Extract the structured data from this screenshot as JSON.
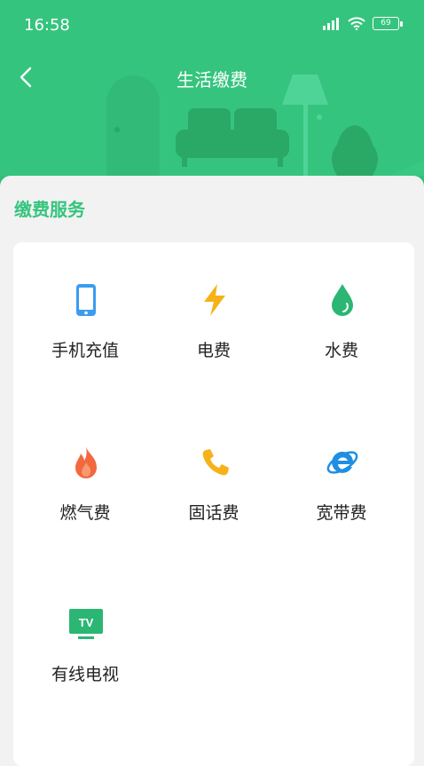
{
  "status_bar": {
    "time": "16:58",
    "battery": "69"
  },
  "header": {
    "title": "生活缴费"
  },
  "section": {
    "title": "缴费服务"
  },
  "services": [
    {
      "label": "手机充值",
      "icon": "phone-icon"
    },
    {
      "label": "电费",
      "icon": "lightning-icon"
    },
    {
      "label": "水费",
      "icon": "water-drop-icon"
    },
    {
      "label": "燃气费",
      "icon": "flame-icon"
    },
    {
      "label": "固话费",
      "icon": "telephone-icon"
    },
    {
      "label": "宽带费",
      "icon": "internet-explorer-icon"
    },
    {
      "label": "有线电视",
      "icon": "tv-icon"
    }
  ],
  "colors": {
    "brand": "#35c47e",
    "phone": "#3a9cf0",
    "lightning": "#f5b319",
    "water": "#2bb673",
    "flame": "#f2693f",
    "tv": "#2bb673"
  }
}
